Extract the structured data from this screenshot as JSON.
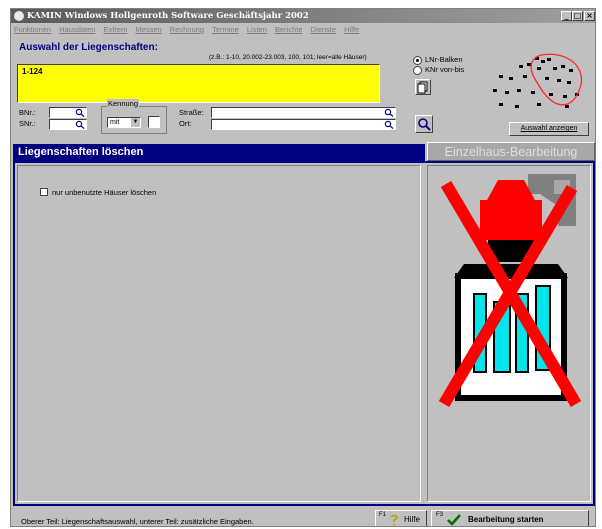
{
  "window": {
    "title": "KAMIN Windows   Hollgenroth Software   Geschäftsjahr 2002",
    "controls": [
      "_",
      "□",
      "×"
    ]
  },
  "menu": [
    "Funktionen",
    "Hausdaten",
    "Exfrem",
    "Messen",
    "Rechnung",
    "Termine",
    "Listen",
    "Berichte",
    "Dienste",
    "Hilfe"
  ],
  "selection": {
    "title": "Auswahl der Liegenschaften:",
    "hint": "(z.B.: 1-10, 20.002-23.003, 100, 101; leer=alle Häuser)",
    "value": "1-124",
    "radio_ln": "LNr-Balken",
    "radio_knr": "KNr von-bis",
    "bnr_label": "BNr.:",
    "snr_label": "SNr.:",
    "kennung_label": "Kennung",
    "kennung_value": "mit",
    "strasse_label": "Straße:",
    "ort_label": "Ort:",
    "show_button": "Auswahl anzeigen"
  },
  "tabs": {
    "active": "Liegenschaften löschen",
    "inactive": "Einzelhaus-Bearbeitung"
  },
  "options": {
    "checkbox_label": "nur unbenutzte Häuser löschen",
    "checked": false
  },
  "status_text": "Oberer Teil: Liegenschaftsauswahl,  unterer Teil: zusätzliche Eingaben.",
  "buttons": {
    "help_key": "F1",
    "help_label": "Hilfe",
    "start_key": "F3",
    "start_label": "Bearbeitung starten"
  },
  "colors": {
    "accent": "#000080",
    "input_highlight": "#ffff00",
    "delete_x": "#ff0000",
    "window_glass": "#00e5ee"
  }
}
